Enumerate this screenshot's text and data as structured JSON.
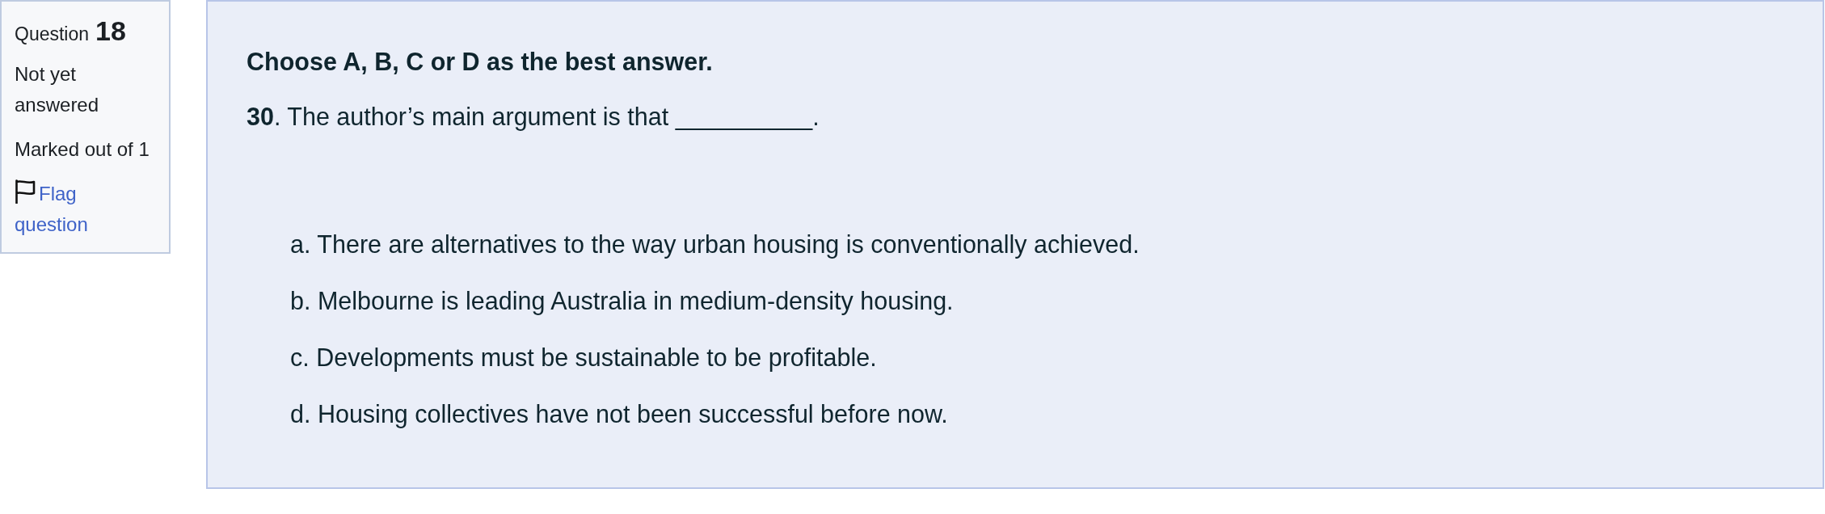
{
  "question_info": {
    "label": "Question",
    "number": "18",
    "status": "Not yet answered",
    "marks": "Marked out of 1",
    "flag_link": "Flag question"
  },
  "question": {
    "instruction": "Choose A, B, C or D as the best answer.",
    "prompt": "**30**. The author’s main argument is that __________.",
    "options": [
      {
        "text": "a. There are alternatives to the way urban housing is conventionally achieved."
      },
      {
        "text": "b. Melbourne is leading Australia in medium-density housing."
      },
      {
        "text": "c. Developments must be sustainable to be profitable."
      },
      {
        "text": "d. Housing collectives have not been successful before now."
      }
    ]
  }
}
